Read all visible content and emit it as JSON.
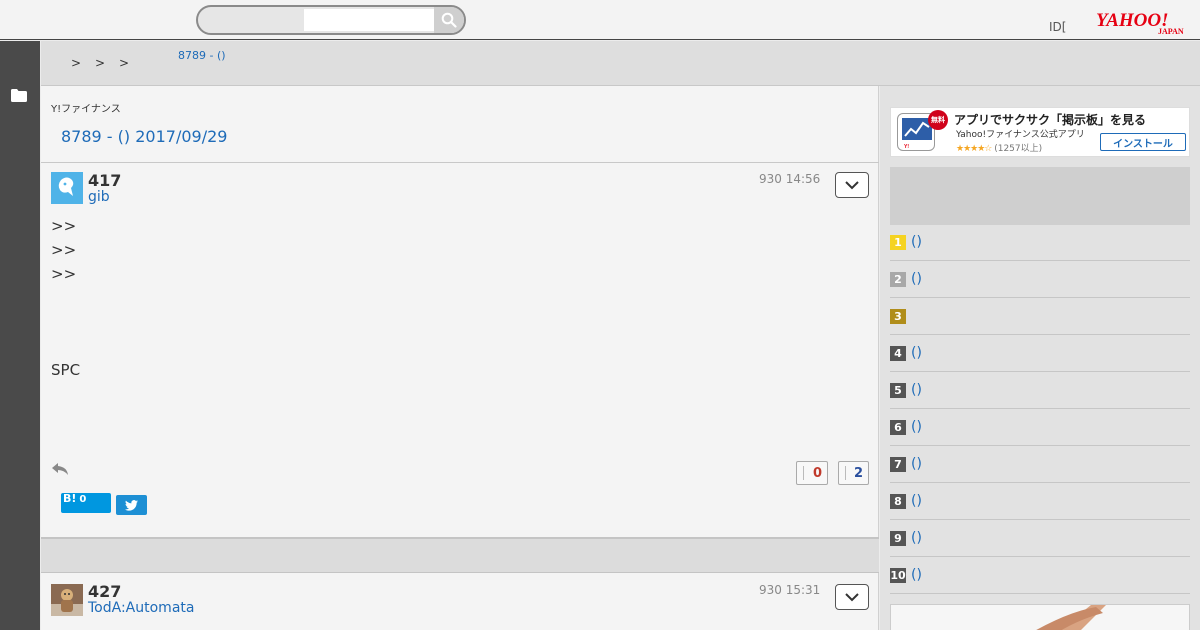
{
  "header": {
    "search_placeholder": "",
    "id_label": "ID[",
    "logo_text": "YAHOO!",
    "logo_sub": "JAPAN"
  },
  "breadcrumb": {
    "separators": [
      ">",
      ">",
      ">"
    ],
    "current": "8789 - ()"
  },
  "main": {
    "brand_logo": "Y!ファイナンス",
    "page_title": "8789 -  () 2017/09/29"
  },
  "posts": [
    {
      "number": "417",
      "user": "gib",
      "time": "930 14:56",
      "lines": [
        ">>",
        ">>",
        ">>",
        "",
        "",
        "",
        "SPC"
      ],
      "vote_good": "0",
      "vote_bad": "2",
      "hatena_label": "B!",
      "hatena_count": "0"
    },
    {
      "number": "427",
      "user": "TodA:Automata",
      "time": "930 15:31"
    }
  ],
  "sidebar": {
    "app_banner": {
      "free_badge": "無料",
      "title": "アプリでサクサク「掲示板」を見る",
      "subtitle": "Yahoo!ファイナンス公式アプリ",
      "stars": "★★★★☆",
      "rating": "(1257以上)",
      "install_label": "インストール"
    },
    "ranking": [
      {
        "rank": "1",
        "label": "()",
        "color": "#f5d321"
      },
      {
        "rank": "2",
        "label": "()",
        "color": "#a8a8a8"
      },
      {
        "rank": "3",
        "label": "",
        "color": "#b08d1a"
      },
      {
        "rank": "4",
        "label": "()",
        "color": "#555555"
      },
      {
        "rank": "5",
        "label": "()",
        "color": "#555555"
      },
      {
        "rank": "6",
        "label": "()",
        "color": "#555555"
      },
      {
        "rank": "7",
        "label": "()",
        "color": "#555555"
      },
      {
        "rank": "8",
        "label": "()",
        "color": "#555555"
      },
      {
        "rank": "9",
        "label": "()",
        "color": "#555555"
      },
      {
        "rank": "10",
        "label": "()",
        "color": "#555555"
      }
    ]
  },
  "colors": {
    "link": "#1e6bb8",
    "brand_red": "#e60012",
    "vote_good": "#c0392b",
    "vote_bad": "#2a4f9e"
  }
}
